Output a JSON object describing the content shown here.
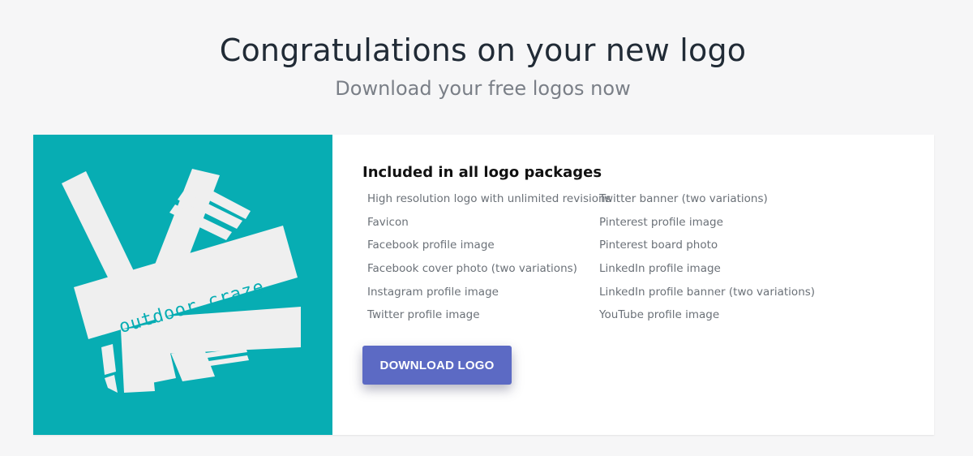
{
  "header": {
    "title": "Congratulations on your new logo",
    "subtitle": "Download your free logos now"
  },
  "logo": {
    "text": "outdoor craze",
    "background_color": "#07adb3",
    "shape_color": "#efefef"
  },
  "package": {
    "heading": "Included in all logo packages",
    "left_items": [
      "High resolution logo with unlimited revisions",
      "Favicon",
      "Facebook profile image",
      "Facebook cover photo (two variations)",
      "Instagram profile image",
      "Twitter profile image"
    ],
    "right_items": [
      "Twitter banner (two variations)",
      "Pinterest profile image",
      "Pinterest board photo",
      "LinkedIn profile image",
      "LinkedIn profile banner (two variations)",
      "YouTube profile image"
    ]
  },
  "actions": {
    "download_label": "DOWNLOAD LOGO",
    "accent_color": "#5c6ac4"
  }
}
